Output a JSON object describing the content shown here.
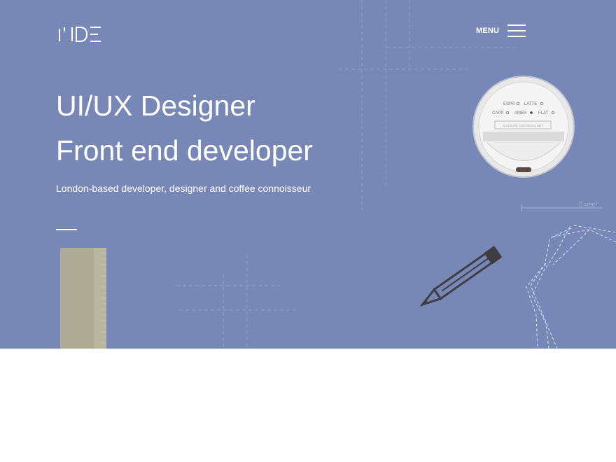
{
  "header": {
    "logo_text": "MDE",
    "menu_label": "MENU"
  },
  "hero": {
    "headline_1": "UI/UX Designer",
    "headline_2": "Front end developer",
    "tagline": "London-based developer, designer and coffee connoisseur"
  },
  "cup_lid": {
    "labels": [
      "ESPR",
      "LATTE",
      "CAPP",
      "AMER",
      "FLAT"
    ],
    "selected": "AMER",
    "caution": "CAUTION: CONTENTS HOT"
  },
  "formula": "E=mc²",
  "colors": {
    "hero_bg": "#7788b6",
    "text": "#ffffff",
    "lower_bg": "#ffffff"
  },
  "icons": [
    "hamburger-menu-icon",
    "coffee-lid-illustration",
    "pencil-illustration",
    "ruler-illustration",
    "crumpled-paper-illustration"
  ]
}
